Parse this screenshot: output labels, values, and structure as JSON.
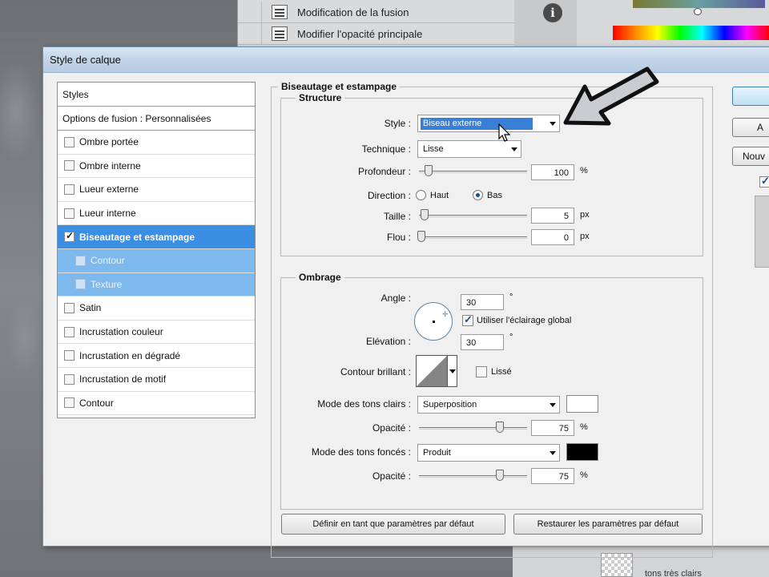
{
  "workspace": {
    "history": [
      {
        "label": "Modification de la fusion"
      },
      {
        "label": "Modifier l'opacité principale"
      }
    ],
    "info_icon": "info-icon",
    "layers_bottom_label": "tons très clairs"
  },
  "dialog": {
    "title": "Style de calque",
    "style_list": {
      "header": "Styles",
      "blending": "Options de fusion : Personnalisées",
      "items": [
        {
          "label": "Ombre portée",
          "checked": false
        },
        {
          "label": "Ombre interne",
          "checked": false
        },
        {
          "label": "Lueur externe",
          "checked": false
        },
        {
          "label": "Lueur interne",
          "checked": false
        },
        {
          "label": "Biseautage et estampage",
          "checked": true,
          "selected": true
        },
        {
          "label": "Contour",
          "checked": false,
          "sub": true
        },
        {
          "label": "Texture",
          "checked": false,
          "sub": true
        },
        {
          "label": "Satin",
          "checked": false
        },
        {
          "label": "Incrustation couleur",
          "checked": false
        },
        {
          "label": "Incrustation en dégradé",
          "checked": false
        },
        {
          "label": "Incrustation de motif",
          "checked": false
        },
        {
          "label": "Contour",
          "checked": false
        }
      ]
    },
    "bevel": {
      "group_title": "Biseautage et estampage",
      "structure": {
        "title": "Structure",
        "style_label": "Style :",
        "style_value": "Biseau externe",
        "technique_label": "Technique :",
        "technique_value": "Lisse",
        "depth_label": "Profondeur :",
        "depth_value": "100",
        "depth_unit": "%",
        "direction_label": "Direction :",
        "direction_up": "Haut",
        "direction_down": "Bas",
        "direction_selected": "Bas",
        "size_label": "Taille :",
        "size_value": "5",
        "size_unit": "px",
        "soften_label": "Flou :",
        "soften_value": "0",
        "soften_unit": "px"
      },
      "shading": {
        "title": "Ombrage",
        "angle_label": "Angle :",
        "angle_value": "30",
        "degree": "°",
        "global_light_label": "Utiliser l'éclairage global",
        "global_light_checked": true,
        "altitude_label": "Elévation :",
        "altitude_value": "30",
        "gloss_label": "Contour brillant :",
        "antialias_label": "Lissé",
        "antialias_checked": false,
        "highlight_mode_label": "Mode des tons clairs :",
        "highlight_mode_value": "Superposition",
        "highlight_color": "#ffffff",
        "highlight_opacity_label": "Opacité :",
        "highlight_opacity_value": "75",
        "shadow_mode_label": "Mode des tons foncés :",
        "shadow_mode_value": "Produit",
        "shadow_color": "#000000",
        "shadow_opacity_label": "Opacité :",
        "shadow_opacity_value": "75",
        "percent": "%"
      },
      "make_default_label": "Définir en tant que paramètres par défaut",
      "reset_default_label": "Restaurer les paramètres par défaut"
    },
    "side_buttons": {
      "ok": "",
      "cancel": "A",
      "new_style": "Nouv"
    }
  }
}
